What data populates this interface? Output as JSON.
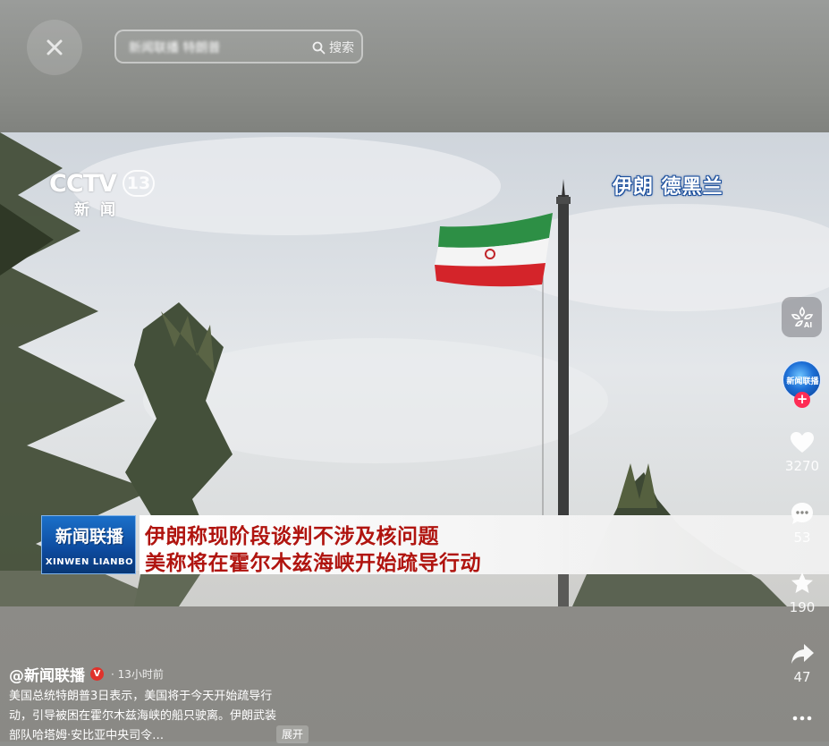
{
  "header": {
    "search_placeholder": "新闻联播 特朗普",
    "search_button_label": "搜索"
  },
  "video": {
    "watermark_brand": "CCTV",
    "watermark_channel": "13",
    "watermark_sub": "新闻",
    "location_tag": "伊朗 德黑兰",
    "news_logo_name": "新闻联播",
    "news_logo_pinyin": "XINWEN LIANBO",
    "headline_line1": "伊朗称现阶段谈判不涉及核问题",
    "headline_line2": "美称将在霍尔木兹海峡开始疏导行动"
  },
  "rail": {
    "avatar_label": "新闻联播",
    "likes": "3270",
    "comments": "53",
    "favorites": "190",
    "shares": "47"
  },
  "post": {
    "author": "@新闻联播",
    "verified_mark": "V",
    "time": "· 13小时前",
    "caption": "美国总统特朗普3日表示，美国将于今天开始疏导行动，引导被困在霍尔木兹海峡的船只驶离。伊朗武装部队哈塔姆·安比亚中央司令…",
    "expand_label": "展开"
  },
  "colors": {
    "accent_red": "#fe2c55",
    "headline_red": "#b0140f",
    "news_blue": "#0d4a9e"
  },
  "icons": [
    "close-icon",
    "search-icon",
    "ai-icon",
    "heart-icon",
    "comment-icon",
    "star-icon",
    "share-icon",
    "more-icon"
  ]
}
